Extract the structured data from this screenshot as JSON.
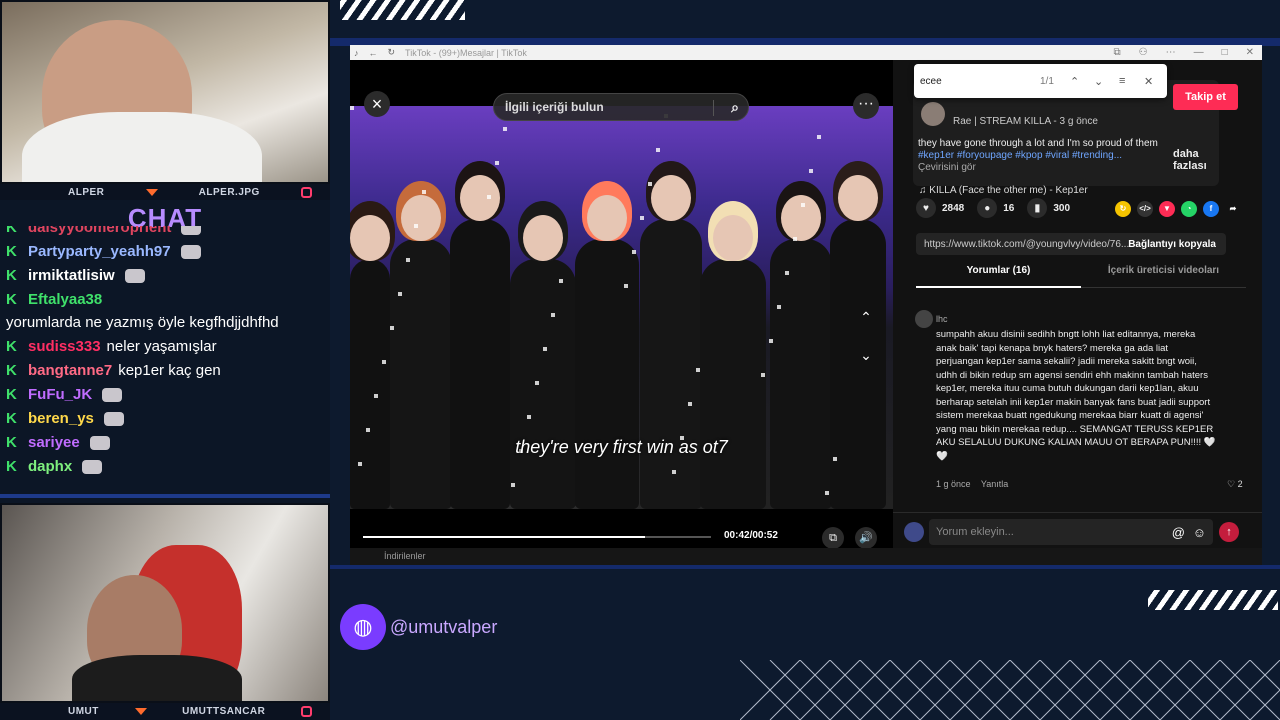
{
  "cams": {
    "top_left_label": "ALPER",
    "top_right_label": "ALPER.JPG",
    "bottom_left_label": "UMUT",
    "bottom_right_label": "UMUTTSANCAR"
  },
  "chat": {
    "title": "CHAT",
    "badge": "K",
    "messages": [
      {
        "user": "daisyyoomeroprient",
        "text": "",
        "color": "#e0455f",
        "emote": true
      },
      {
        "user": "Partyparty_yeahh97",
        "text": "",
        "color": "#9ab8ff",
        "emote": true
      },
      {
        "user": "irmiktatlisiw",
        "text": "",
        "color": "#ffffff",
        "emote": true
      },
      {
        "user": "Eftalyaa38",
        "text": "yorumlarda ne yazmış öyle kegfhdjjdhfhd",
        "color": "#3fe06a",
        "emote": false
      },
      {
        "user": "sudiss333",
        "text": "neler yaşamışlar",
        "color": "#ff2e63",
        "emote": false
      },
      {
        "user": "bangtanne7",
        "text": "kep1er kaç gen",
        "color": "#ff6a85",
        "emote": false
      },
      {
        "user": "FuFu_JK",
        "text": "",
        "color": "#c06cff",
        "emote": true
      },
      {
        "user": "beren_ys",
        "text": "",
        "color": "#ffd84a",
        "emote": true
      },
      {
        "user": "sariyee",
        "text": "",
        "color": "#c06cff",
        "emote": true
      },
      {
        "user": "daphx",
        "text": "",
        "color": "#7ef07e",
        "emote": true
      }
    ]
  },
  "social": {
    "handle": "@umutvalper"
  },
  "browser": {
    "tab_title": "TikTok - (99+)Mesajlar | TikTok"
  },
  "video": {
    "search_placeholder": "İlgili içeriği bulun",
    "subtitle": "they're very first win as ot7",
    "time": "00:42/00:52",
    "progress_fraction": 0.81
  },
  "panel": {
    "find": {
      "query": "ecee",
      "count": "1/1"
    },
    "follow_label": "Takip et",
    "author": "Rae | STREAM KILLA",
    "posted": "- 3 g önce",
    "desc_line1": "they have gone through a lot and I'm so proud of them",
    "desc_tags": "#kep1er #foryoupage #kpop #viral #trending...",
    "see_translation": "Çevirisini gör",
    "more_label": "daha fazlası",
    "music": "KILLA (Face the other me) - Kep1er",
    "likes": "2848",
    "comments": "16",
    "saves": "300",
    "url": "https://www.tiktok.com/@youngvlvy/video/76...",
    "copy_label": "Bağlantıyı kopyala",
    "tab_comments": "Yorumlar (16)",
    "tab_creator": "İçerik üreticisi videoları",
    "comment": {
      "user": "lhc",
      "text": "sumpahh akuu disinii sedihh bngtt lohh liat editannya, mereka anak baik' tapi kenapa bnyk haters? mereka ga ada liat perjuangan kep1er sama sekalii? jadii mereka sakitt bngt woii, udhh di bikin redup sm agensi sendiri ehh makinn tambah haters kep1er, mereka ituu cuma butuh dukungan darii kep1lan, akuu berharap setelah inii kep1er makin banyak fans buat jadii support sistem merekaa buatt ngedukung merekaa biarr kuatt di agensi' yang mau bikin merekaa redup.... SEMANGAT TERUSS KEP1ER AKU SELALUU DUKUNG KALIAN MAUU OT BERAPA PUN!!!! 🤍🤍",
      "age": "1 g önce",
      "reply": "Yanıtla",
      "likes": "2"
    },
    "comment_placeholder": "Yorum ekleyin..."
  },
  "bottom_strip": "İndirilenler"
}
